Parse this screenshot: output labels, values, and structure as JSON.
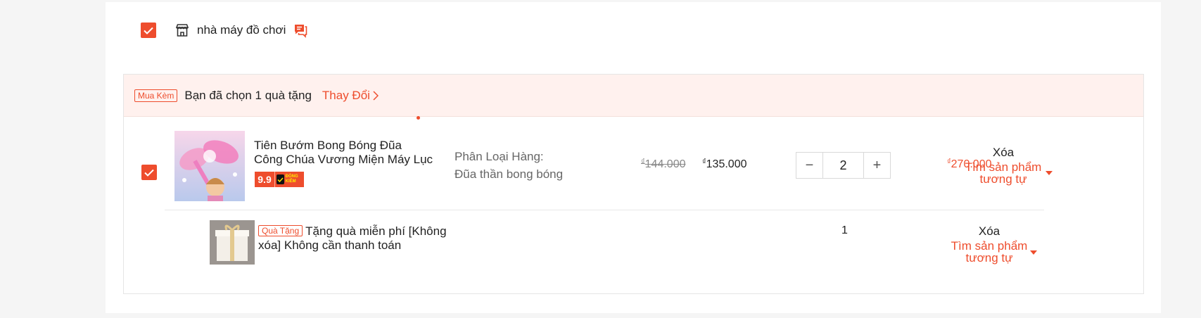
{
  "shop": {
    "name": "nhà máy đồ chơi",
    "checked": true
  },
  "promo": {
    "tag": "Mua Kèm",
    "text": "Bạn đã chọn 1 quà tặng",
    "link": "Thay Đổi"
  },
  "item": {
    "checked": true,
    "name": "Tiên Bướm Bong Bóng Đũa Công Chúa Vương Miện Máy Lục ...",
    "badges": {
      "sale": "9.9",
      "verified": "ĐÓNG KIỂM"
    },
    "variation_label": "Phân Loại Hàng:",
    "variation_value": "Đũa thần bong bóng",
    "currency": "₫",
    "price_old": "144.000",
    "price_new": "135.000",
    "quantity": "2",
    "decrease": "−",
    "increase": "+",
    "total": "270.000",
    "delete_label": "Xóa",
    "similar_label": "Tìm sản phẩm tương tự"
  },
  "gift": {
    "tag": "Quà Tặng",
    "text": "Tặng quà miễn phí [Không xóa] Không cần thanh toán",
    "quantity": "1",
    "delete_label": "Xóa",
    "similar_label": "Tìm sản phẩm tương tự"
  },
  "colors": {
    "accent": "#ee4d2d",
    "promo_bg": "#fff1ee"
  },
  "icons": [
    "check-icon",
    "store-icon",
    "chat-icon",
    "chevron-right-icon",
    "caret-down-icon"
  ]
}
